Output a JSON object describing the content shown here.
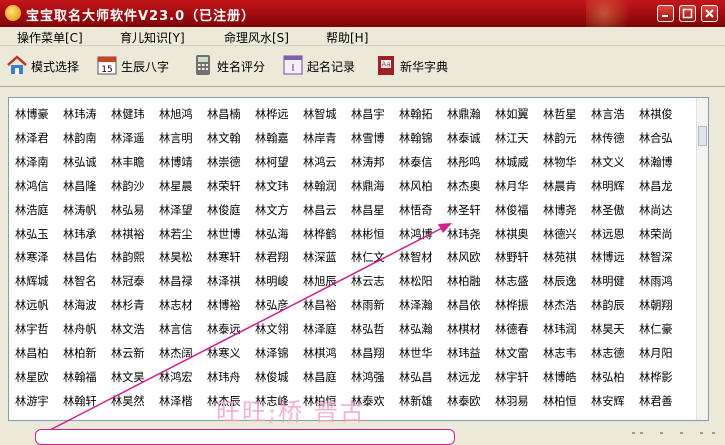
{
  "window": {
    "title": "宝宝取名大师软件V23.0（已注册）"
  },
  "menu": {
    "items": [
      "操作菜单[C]",
      "育儿知识[Y]",
      "命理风水[S]",
      "帮助[H]"
    ]
  },
  "toolbar": {
    "buttons": [
      {
        "label": "模式选择",
        "icon": "house-icon"
      },
      {
        "label": "生辰八字",
        "icon": "calendar-icon"
      },
      {
        "label": "姓名评分",
        "icon": "calculator-icon"
      },
      {
        "label": "起名记录",
        "icon": "record-icon"
      },
      {
        "label": "新华字典",
        "icon": "dictionary-icon"
      }
    ]
  },
  "names": [
    [
      "林博豪",
      "林玮涛",
      "林健玮",
      "林旭鸿",
      "林昌楠",
      "林桦远",
      "林智城",
      "林昌宇",
      "林翰拓",
      "林鼎瀚",
      "林如翼",
      "林哲星",
      "林言浩",
      "林祺俊"
    ],
    [
      "林泽君",
      "林韵南",
      "林泽遥",
      "林言明",
      "林文翰",
      "林翰嘉",
      "林岸青",
      "林雪博",
      "林翰锦",
      "林泰诚",
      "林江天",
      "林韵元",
      "林传德",
      "林合弘"
    ],
    [
      "林泽南",
      "林弘诚",
      "林丰瞻",
      "林博靖",
      "林崇德",
      "林柯望",
      "林鸿云",
      "林涛邦",
      "林泰信",
      "林彤鸣",
      "林城威",
      "林物华",
      "林文义",
      "林瀚博"
    ],
    [
      "林鸿信",
      "林昌隆",
      "林韵沙",
      "林星晨",
      "林荣轩",
      "林文玮",
      "林翰润",
      "林鼎海",
      "林风柏",
      "林杰奥",
      "林月华",
      "林晨肯",
      "林明辉",
      "林昌龙"
    ],
    [
      "林浩庭",
      "林涛帆",
      "林弘易",
      "林泽望",
      "林俊庭",
      "林文方",
      "林昌云",
      "林昌星",
      "林悟奇",
      "林圣轩",
      "林俊福",
      "林博尧",
      "林圣傲",
      "林尚达"
    ],
    [
      "林弘玉",
      "林玮承",
      "林祺裕",
      "林若尘",
      "林世博",
      "林弘海",
      "林桦鹤",
      "林彬恒",
      "林鸿博",
      "林玮尧",
      "林祺奥",
      "林德兴",
      "林远恩",
      "林荣尚"
    ],
    [
      "林寒泽",
      "林昌佑",
      "林韵熙",
      "林昊松",
      "林寒轩",
      "林君翔",
      "林深蓝",
      "林仁文",
      "林智材",
      "林风欧",
      "林野轩",
      "林苑祺",
      "林博远",
      "林智深"
    ],
    [
      "林辉城",
      "林智名",
      "林冠泰",
      "林昌禄",
      "林泽祺",
      "林明峻",
      "林旭辰",
      "林云志",
      "林松阳",
      "林柏融",
      "林志盛",
      "林辰逸",
      "林明健",
      "林雨鸿"
    ],
    [
      "林远帆",
      "林海波",
      "林杉青",
      "林志材",
      "林博裕",
      "林弘彦",
      "林昌裕",
      "林雨新",
      "林泽瀚",
      "林昌依",
      "林桦振",
      "林杰浩",
      "林韵辰",
      "林朝翔"
    ],
    [
      "林宇哲",
      "林舟帆",
      "林文浩",
      "林言信",
      "林泰远",
      "林文翎",
      "林泽庭",
      "林弘哲",
      "林弘瀚",
      "林棋材",
      "林德春",
      "林玮润",
      "林昊天",
      "林仁豪"
    ],
    [
      "林昌柏",
      "林柏新",
      "林云新",
      "林杰阔",
      "林寒义",
      "林泽锦",
      "林棋鸿",
      "林昌翔",
      "林世华",
      "林玮益",
      "林文雷",
      "林志韦",
      "林志德",
      "林月阳"
    ],
    [
      "林星欧",
      "林翰福",
      "林文昊",
      "林鸿宏",
      "林玮舟",
      "林俊城",
      "林昌庭",
      "林鸿强",
      "林弘昌",
      "林远龙",
      "林宇轩",
      "林博皓",
      "林弘柏",
      "林桦影"
    ],
    [
      "林游宇",
      "林翰轩",
      "林昊然",
      "林泽楷",
      "林杰辰",
      "林志峰",
      "林柏恒",
      "林泰欢",
      "林新雄",
      "林泰欧",
      "林羽易",
      "林柏恒",
      "林安辉",
      "林君善"
    ]
  ],
  "watermark": "旺旺;桥 普古",
  "colors": {
    "titlebar": "#a40e12",
    "arrow": "#d0208c",
    "panel_border": "#7f9db9"
  }
}
